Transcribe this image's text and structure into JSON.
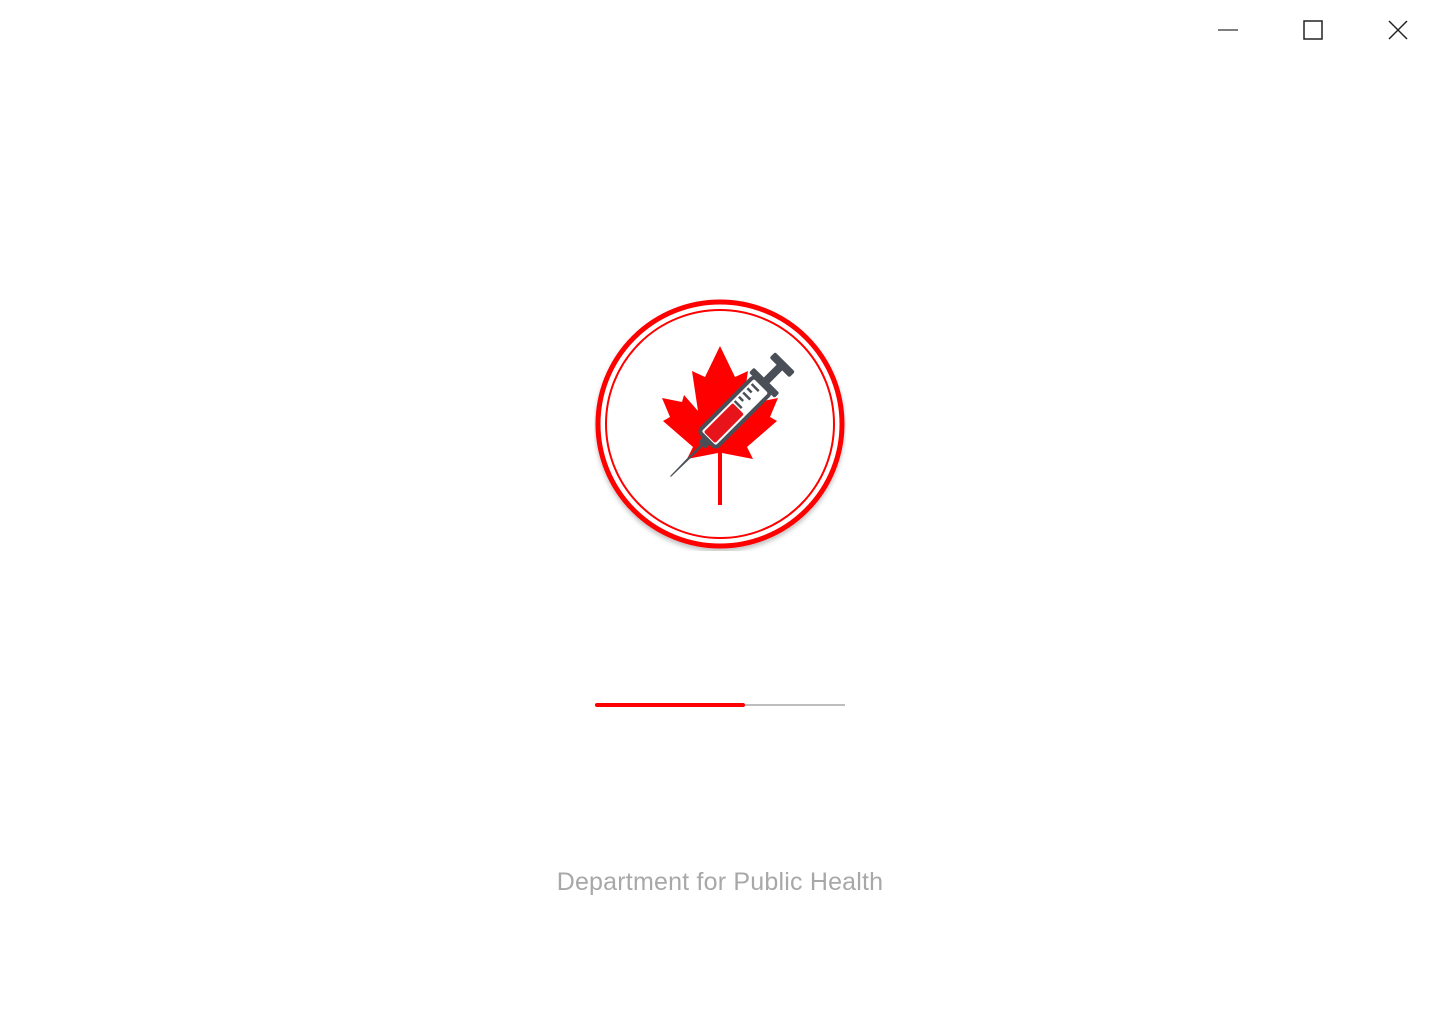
{
  "window": {
    "controls": {
      "minimize": "minimize-icon",
      "maximize": "maximize-icon",
      "close": "close-icon"
    }
  },
  "splash": {
    "logo": {
      "icon": "maple-leaf-syringe-logo",
      "ring_color": "#ff0000",
      "leaf_color": "#ff0000",
      "syringe_color": "#4a4f57"
    },
    "progress": {
      "value": 0.6,
      "fill_color": "#ff0000",
      "track_color": "#bdbdbd"
    },
    "org_name": "Department for Public Health"
  }
}
